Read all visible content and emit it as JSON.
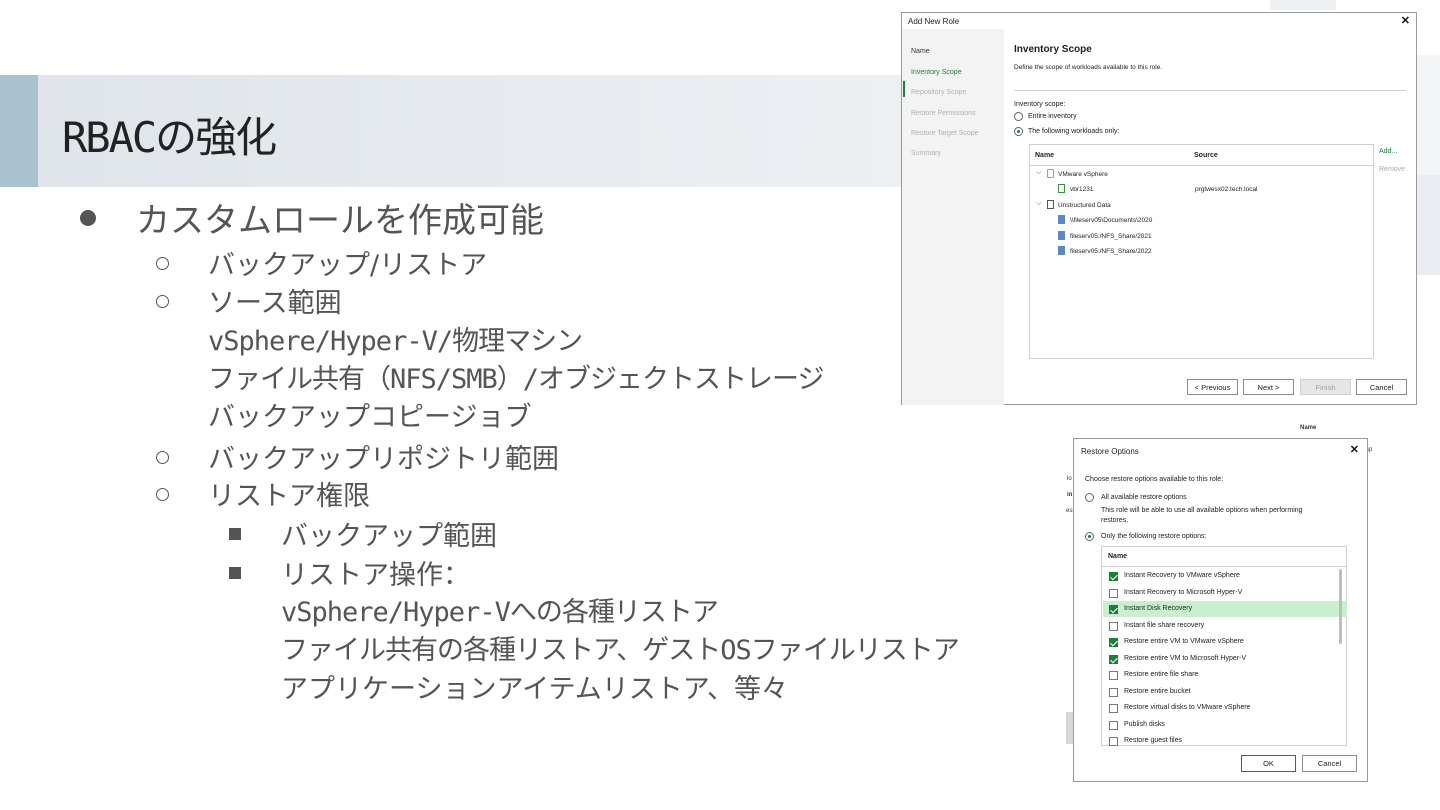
{
  "slide": {
    "title": "RBACの強化",
    "bullets": [
      {
        "level": 1,
        "text": "カスタムロールを作成可能"
      },
      {
        "level": 2,
        "text": "バックアップ/リストア"
      },
      {
        "level": 2,
        "text": "ソース範囲"
      },
      {
        "level": 2,
        "text": "vSphere/Hyper-V/物理マシン",
        "continuation": true
      },
      {
        "level": 2,
        "text": "ファイル共有（NFS/SMB）/オブジェクトストレージ",
        "continuation": true
      },
      {
        "level": 2,
        "text": "バックアップコピージョブ",
        "continuation": true
      },
      {
        "level": 2,
        "text": "バックアップリポジトリ範囲"
      },
      {
        "level": 2,
        "text": "リストア権限"
      },
      {
        "level": 3,
        "text": "バックアップ範囲"
      },
      {
        "level": 3,
        "text": "リストア操作："
      },
      {
        "level": 3,
        "text": "vSphere/Hyper-Vへの各種リストア",
        "continuation": true
      },
      {
        "level": 3,
        "text": "ファイル共有の各種リストア、ゲストOSファイルリストア",
        "continuation": true
      },
      {
        "level": 3,
        "text": "アプリケーションアイテムリストア、等々",
        "continuation": true
      }
    ]
  },
  "add_role_dialog": {
    "title": "Add New Role",
    "close": "✕",
    "nav": [
      "Name",
      "Inventory Scope",
      "Repository Scope",
      "Restore Permissions",
      "Restore Target Scope",
      "Summary"
    ],
    "active_nav": "Inventory Scope",
    "section_title": "Inventory Scope",
    "section_desc": "Define the scope of workloads available to this role.",
    "scope_label": "Inventory scope:",
    "options": [
      "Entire inventory",
      "The following workloads only:"
    ],
    "selected_option": "The following workloads only:",
    "table": {
      "columns": [
        "Name",
        "Source"
      ],
      "rows": [
        {
          "name": "VMware vSphere",
          "source": "",
          "depth": 0
        },
        {
          "name": "vbr1231",
          "source": "prgtwesx02.tech.local",
          "depth": 1
        },
        {
          "name": "Unstructured Data",
          "source": "",
          "depth": 0
        },
        {
          "name": "\\\\fileserv05\\Documents\\2020",
          "source": "",
          "depth": 1
        },
        {
          "name": "fileserv05:/NFS_Share/2021",
          "source": "",
          "depth": 1
        },
        {
          "name": "fileserv05:/NFS_Share/2022",
          "source": "",
          "depth": 1
        }
      ]
    },
    "side_actions": {
      "add": "Add...",
      "remove": "Remove"
    },
    "buttons": {
      "previous": "< Previous",
      "next": "Next >",
      "finish": "Finish",
      "cancel": "Cancel"
    }
  },
  "restore_dialog": {
    "title": "Restore Options",
    "close": "✕",
    "prompt": "Choose restore options available to this role:",
    "opt_all": "All available restore options",
    "opt_all_desc_1": "This role will be able to use all available options when performing",
    "opt_all_desc_2": "restores.",
    "opt_only": "Only the following restore options:",
    "selected": "Only the following restore options:",
    "col_name": "Name",
    "items": [
      {
        "label": "Instant Recovery to VMware vSphere",
        "checked": true
      },
      {
        "label": "Instant Recovery to Microsoft Hyper-V",
        "checked": false
      },
      {
        "label": "Instant Disk Recovery",
        "checked": true
      },
      {
        "label": "Instant file share recovery",
        "checked": false
      },
      {
        "label": "Restore entire VM to VMware vSphere",
        "checked": true
      },
      {
        "label": "Restore entire VM to Microsoft Hyper-V",
        "checked": true
      },
      {
        "label": "Restore entire file share",
        "checked": false
      },
      {
        "label": "Restore entire bucket",
        "checked": false
      },
      {
        "label": "Restore virtual disks to VMware vSphere",
        "checked": false
      },
      {
        "label": "Publish disks",
        "checked": false
      },
      {
        "label": "Restore guest files",
        "checked": false
      }
    ],
    "highlighted_item": "Instant Disk Recovery",
    "buttons": {
      "ok": "OK",
      "cancel": "Cancel"
    }
  },
  "background_fragments": {
    "name_label": "Name",
    "sp": "sp",
    "lo": "lo",
    "in": "in",
    "es": "ess"
  },
  "colors": {
    "accent_green": "#1a7f37",
    "title_band": "#e4e8ec",
    "title_accent": "#a9c2d0",
    "highlight_row": "#c8f0d0"
  }
}
